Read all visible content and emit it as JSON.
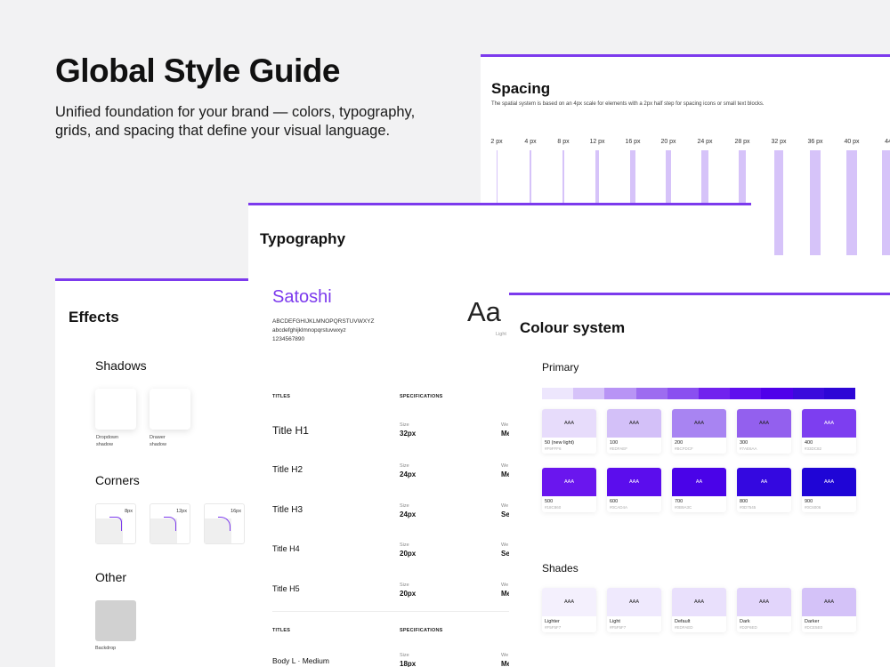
{
  "hero": {
    "title": "Global Style Guide",
    "subtitle": "Unified foundation for your brand — colors, typography, grids, and spacing that define your visual language."
  },
  "accent_color": "#7c3aed",
  "spacing": {
    "title": "Spacing",
    "description": "The spatial system is based on an 4px  scale for elements with a 2px half step for spacing icons or small text blocks.",
    "steps": [
      {
        "label": "2 px",
        "value": 2
      },
      {
        "label": "4 px",
        "value": 4
      },
      {
        "label": "8 px",
        "value": 8
      },
      {
        "label": "12 px",
        "value": 12
      },
      {
        "label": "16 px",
        "value": 16
      },
      {
        "label": "20 px",
        "value": 20
      },
      {
        "label": "24 px",
        "value": 24
      },
      {
        "label": "28 px",
        "value": 28
      },
      {
        "label": "32 px",
        "value": 32
      },
      {
        "label": "36 px",
        "value": 36
      },
      {
        "label": "40 px",
        "value": 40
      },
      {
        "label": "44",
        "value": 44
      }
    ]
  },
  "typography": {
    "title": "Typography",
    "font_name": "Satoshi",
    "uppercase": "ABCDEFGHIJKLMNOPQRSTUVWXYZ",
    "lowercase": "abcdefghijklmnopqrstuvwxyz",
    "digits": "1234567890",
    "sample": "Aa",
    "sample_weight": "Light",
    "col_titles": "TITLES",
    "col_specs": "SPECIFICATIONS",
    "rows": [
      {
        "name": "Title H1",
        "size_label": "Size",
        "size": "32px",
        "weight_label": "We",
        "weight": "Me"
      },
      {
        "name": "Title H2",
        "size_label": "Size",
        "size": "24px",
        "weight_label": "We",
        "weight": "Me"
      },
      {
        "name": "Title H3",
        "size_label": "Size",
        "size": "24px",
        "weight_label": "We",
        "weight": "Se"
      },
      {
        "name": "Title H4",
        "size_label": "Size",
        "size": "20px",
        "weight_label": "We",
        "weight": "Se"
      },
      {
        "name": "Title H5",
        "size_label": "Size",
        "size": "20px",
        "weight_label": "We",
        "weight": "Me"
      }
    ],
    "body_col_titles": "TITLES",
    "body_col_specs": "SPECIFICATIONS",
    "body_row": {
      "name": "Body L · Medium",
      "size_label": "Size",
      "size": "18px",
      "weight_label": "We",
      "weight": "Me"
    }
  },
  "effects": {
    "title": "Effects",
    "shadows_title": "Shadows",
    "shadows": [
      {
        "line1": "Dropdown",
        "line2": "shadow"
      },
      {
        "line1": "Drawer",
        "line2": "shadow"
      }
    ],
    "corners_title": "Corners",
    "corners": [
      "8px",
      "12px",
      "16px"
    ],
    "other_title": "Other",
    "backdrop_label": "Backdrop"
  },
  "colour": {
    "title": "Colour system",
    "primary_title": "Primary",
    "ramp": [
      "#ede6fd",
      "#d6c3f9",
      "#b894f5",
      "#9d6cf0",
      "#8a4ff0",
      "#7122ee",
      "#5f0eee",
      "#4f00ea",
      "#3b0bdc",
      "#2d06d6"
    ],
    "primary": [
      {
        "name": "50 (new light)",
        "hex": "#F9FFF6",
        "fill": "#e7dcfb",
        "text": "AAA",
        "text_color": "#222"
      },
      {
        "name": "100",
        "hex": "#EDFAEF",
        "fill": "#d3c0f8",
        "text": "AAA",
        "text_color": "#222"
      },
      {
        "name": "200",
        "hex": "#BCFDCF",
        "fill": "#a884f2",
        "text": "AAA",
        "text_color": "#222"
      },
      {
        "name": "300",
        "hex": "#7AE6AA",
        "fill": "#9360ee",
        "text": "AAA",
        "text_color": "#222"
      },
      {
        "name": "400",
        "hex": "#33DC82",
        "fill": "#7d3ef0",
        "text": "AAA",
        "text_color": "#fff"
      },
      {
        "name": "500",
        "hex": "#18C860",
        "fill": "#6a16ee",
        "text": "AAA",
        "text_color": "#fff"
      },
      {
        "name": "600",
        "hex": "#0CAD4A",
        "fill": "#5b0ded",
        "text": "AAA",
        "text_color": "#fff"
      },
      {
        "name": "700",
        "hex": "#0B9A3C",
        "fill": "#4a03e8",
        "text": "AA",
        "text_color": "#fff"
      },
      {
        "name": "800",
        "hex": "#0D7545",
        "fill": "#3408e0",
        "text": "AA",
        "text_color": "#fff"
      },
      {
        "name": "900",
        "hex": "#0C6006",
        "fill": "#1f05d6",
        "text": "AAA",
        "text_color": "#fff"
      }
    ],
    "shades_title": "Shades",
    "shades": [
      {
        "name": "Lighter",
        "hex": "#F5F5F7",
        "fill": "#f4f0fd",
        "text": "AAA"
      },
      {
        "name": "Light",
        "hex": "#F5F5F7",
        "fill": "#efe9fd",
        "text": "AAA"
      },
      {
        "name": "Default",
        "hex": "#EDFAED",
        "fill": "#e9e0fc",
        "text": "AAA"
      },
      {
        "name": "Dark",
        "hex": "#D2F6ED",
        "fill": "#e2d5fb",
        "text": "AAA"
      },
      {
        "name": "Darker",
        "hex": "#DCE5E0",
        "fill": "#d4c2f8",
        "text": "AAA"
      }
    ]
  }
}
